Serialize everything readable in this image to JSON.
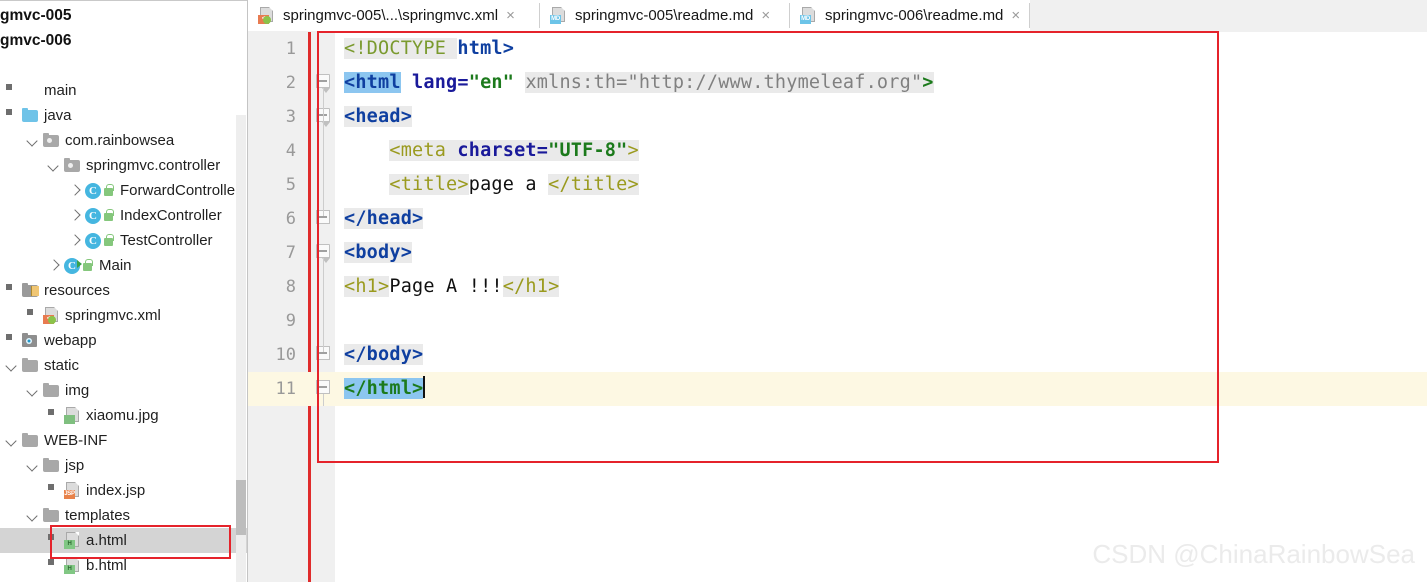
{
  "window": {
    "watermark": "CSDN @ChinaRainbowSea"
  },
  "sidebar": {
    "projects": [
      {
        "label": "gmvc-005"
      },
      {
        "label": "gmvc-006"
      }
    ],
    "tree": [
      {
        "label": "main",
        "indent": 0,
        "arrow": "none",
        "icon": "none",
        "selected": false
      },
      {
        "label": "java",
        "indent": 0,
        "arrow": "none",
        "icon": "folder-blue",
        "selected": false
      },
      {
        "label": "com.rainbowsea",
        "indent": 1,
        "arrow": "down",
        "icon": "folder-gray",
        "selected": false
      },
      {
        "label": "springmvc.controller",
        "indent": 2,
        "arrow": "down",
        "icon": "folder-gray",
        "selected": false
      },
      {
        "label": "ForwardController",
        "indent": 3,
        "arrow": "right",
        "icon": "class",
        "selected": false
      },
      {
        "label": "IndexController",
        "indent": 3,
        "arrow": "right",
        "icon": "class",
        "selected": false
      },
      {
        "label": "TestController",
        "indent": 3,
        "arrow": "right",
        "icon": "class",
        "selected": false
      },
      {
        "label": "Main",
        "indent": 2,
        "arrow": "right",
        "icon": "class-run",
        "selected": false
      },
      {
        "label": "resources",
        "indent": 0,
        "arrow": "none",
        "icon": "folder-src",
        "selected": false
      },
      {
        "label": "springmvc.xml",
        "indent": 1,
        "arrow": "none",
        "icon": "file-xml",
        "selected": false
      },
      {
        "label": "webapp",
        "indent": 0,
        "arrow": "none",
        "icon": "webapp",
        "selected": false
      },
      {
        "label": "static",
        "indent": 0,
        "arrow": "down",
        "icon": "folder-gray2",
        "selected": false
      },
      {
        "label": "img",
        "indent": 1,
        "arrow": "down",
        "icon": "folder-gray2",
        "selected": false
      },
      {
        "label": "xiaomu.jpg",
        "indent": 2,
        "arrow": "none",
        "icon": "file-img",
        "selected": false
      },
      {
        "label": "WEB-INF",
        "indent": 0,
        "arrow": "down",
        "icon": "folder-gray2",
        "selected": false
      },
      {
        "label": "jsp",
        "indent": 1,
        "arrow": "down",
        "icon": "folder-gray2",
        "selected": false
      },
      {
        "label": "index.jsp",
        "indent": 2,
        "arrow": "none",
        "icon": "file-jsp",
        "selected": false
      },
      {
        "label": "templates",
        "indent": 1,
        "arrow": "down",
        "icon": "folder-gray2",
        "selected": false
      },
      {
        "label": "a.html",
        "indent": 2,
        "arrow": "none",
        "icon": "file-html",
        "selected": true
      },
      {
        "label": "b.html",
        "indent": 2,
        "arrow": "none",
        "icon": "file-html",
        "selected": false
      }
    ]
  },
  "tabs": [
    {
      "label": "springmvc-005\\...\\springmvc.xml",
      "icon": "xml-file-icon",
      "close": "×",
      "active": true
    },
    {
      "label": "springmvc-005\\readme.md",
      "icon": "markdown-file-icon",
      "close": "×",
      "active": false
    },
    {
      "label": "springmvc-006\\readme.md",
      "icon": "markdown-file-icon",
      "close": "×",
      "active": false
    }
  ],
  "editor": {
    "current_line": 11,
    "line_numbers": [
      "1",
      "2",
      "3",
      "4",
      "5",
      "6",
      "7",
      "8",
      "9",
      "10",
      "11"
    ],
    "caret": "|",
    "lines": [
      {
        "n": "1",
        "tokens": [
          {
            "t": "<!DOCTYPE ",
            "c": "tok-doctype",
            "bg": "hl-gray"
          },
          {
            "t": "html>",
            "c": "tok-tag",
            "bg": ""
          }
        ]
      },
      {
        "n": "2",
        "tokens": [
          {
            "t": "<html",
            "c": "tok-tag",
            "bg": "hl-blue"
          },
          {
            "t": " ",
            "c": "tok-plain",
            "bg": ""
          },
          {
            "t": "lang=",
            "c": "tok-attr",
            "bg": ""
          },
          {
            "t": "\"en\"",
            "c": "tok-val",
            "bg": ""
          },
          {
            "t": " ",
            "c": "tok-plain",
            "bg": ""
          },
          {
            "t": "xmlns:th=\"http://www.thymeleaf.org\"",
            "c": "tok-gray",
            "bg": "hl-gray"
          },
          {
            "t": ">",
            "c": "tok-green-b",
            "bg": "hl-gray"
          }
        ]
      },
      {
        "n": "3",
        "tokens": [
          {
            "t": "<head>",
            "c": "tok-tag",
            "bg": "hl-gray"
          }
        ]
      },
      {
        "n": "4",
        "tokens": [
          {
            "t": "    ",
            "c": "tok-plain",
            "bg": ""
          },
          {
            "t": "<meta ",
            "c": "tok-tag-y",
            "bg": "hl-gray"
          },
          {
            "t": "charset=",
            "c": "tok-attr",
            "bg": "hl-gray"
          },
          {
            "t": "\"UTF-8\"",
            "c": "tok-val",
            "bg": "hl-gray"
          },
          {
            "t": ">",
            "c": "tok-tag-y",
            "bg": "hl-gray"
          }
        ]
      },
      {
        "n": "5",
        "tokens": [
          {
            "t": "    ",
            "c": "tok-plain",
            "bg": ""
          },
          {
            "t": "<title>",
            "c": "tok-tag-y",
            "bg": "hl-gray"
          },
          {
            "t": "page a ",
            "c": "tok-plain",
            "bg": ""
          },
          {
            "t": "</title>",
            "c": "tok-tag-y",
            "bg": "hl-gray"
          }
        ]
      },
      {
        "n": "6",
        "tokens": [
          {
            "t": "</head>",
            "c": "tok-tag",
            "bg": "hl-gray"
          }
        ]
      },
      {
        "n": "7",
        "tokens": [
          {
            "t": "<body>",
            "c": "tok-tag",
            "bg": "hl-gray"
          }
        ]
      },
      {
        "n": "8",
        "tokens": [
          {
            "t": "<h1>",
            "c": "tok-tag-y",
            "bg": "hl-gray"
          },
          {
            "t": "Page A !!!",
            "c": "tok-plain",
            "bg": ""
          },
          {
            "t": "</h1>",
            "c": "tok-tag-y",
            "bg": "hl-gray"
          }
        ]
      },
      {
        "n": "9",
        "tokens": []
      },
      {
        "n": "10",
        "tokens": [
          {
            "t": "</body>",
            "c": "tok-tag",
            "bg": "hl-gray"
          }
        ]
      },
      {
        "n": "11",
        "tokens": [
          {
            "t": "</html>",
            "c": "tok-green-b",
            "bg": "hl-blue"
          }
        ]
      }
    ]
  }
}
